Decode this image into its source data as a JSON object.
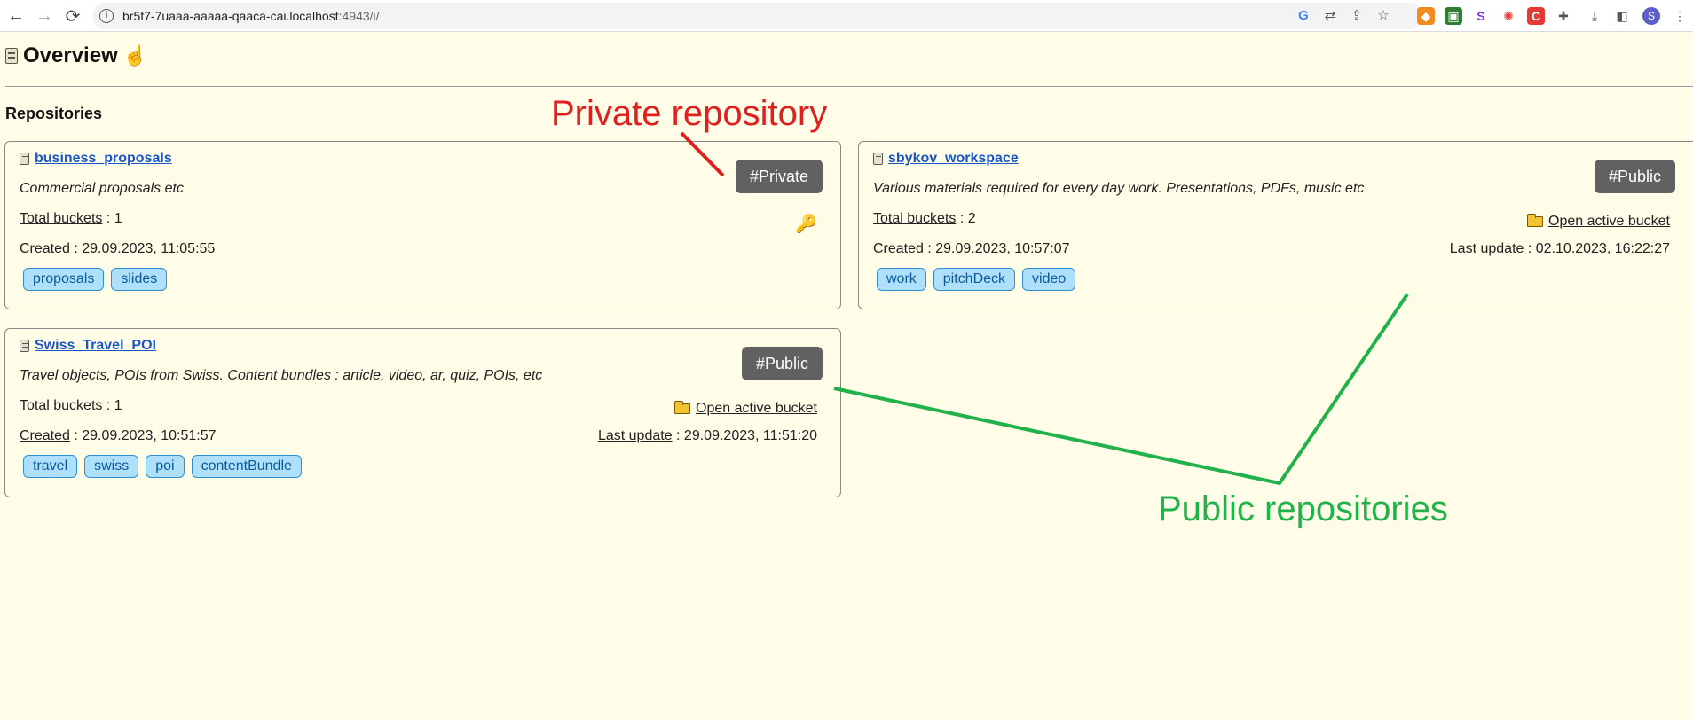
{
  "browser": {
    "url_host": "br5f7-7uaaa-aaaaa-qaaca-cai.localhost",
    "url_path": ":4943/i/"
  },
  "page": {
    "title": "Overview",
    "section_title": "Repositories"
  },
  "repositories": [
    {
      "name": "business_proposals",
      "description": "Commercial proposals etc",
      "total_buckets_label": "Total buckets",
      "total_buckets": " : 1",
      "created_label": "Created",
      "created": " : 29.09.2023, 11:05:55",
      "visibility": "#Private",
      "tags": [
        "proposals",
        "slides"
      ]
    },
    {
      "name": "sbykov_workspace",
      "description": "Various materials required for every day work. Presentations, PDFs, music etc",
      "total_buckets_label": "Total buckets",
      "total_buckets": " : 2",
      "created_label": "Created",
      "created": " : 29.09.2023, 10:57:07",
      "visibility": "#Public",
      "open_bucket": "Open active bucket",
      "last_update_label": "Last update",
      "last_update": " : 02.10.2023, 16:22:27",
      "tags": [
        "work",
        "pitchDeck",
        "video"
      ]
    },
    {
      "name": "Swiss_Travel_POI",
      "description": "Travel objects, POIs from Swiss. Content bundles : article, video, ar, quiz, POIs, etc",
      "total_buckets_label": "Total buckets",
      "total_buckets": " : 1",
      "created_label": "Created",
      "created": " : 29.09.2023, 10:51:57",
      "visibility": "#Public",
      "open_bucket": "Open active bucket",
      "last_update_label": "Last update",
      "last_update": " : 29.09.2023, 11:51:20",
      "tags": [
        "travel",
        "swiss",
        "poi",
        "contentBundle"
      ]
    }
  ],
  "annotations": {
    "private": "Private repository",
    "public": "Public repositories"
  },
  "colors": {
    "background": "#fffde7",
    "link": "#1a55c4",
    "badge": "#616161",
    "tag_bg": "#aee0fb",
    "annotation_private": "#e02020",
    "annotation_public": "#22b24c"
  }
}
